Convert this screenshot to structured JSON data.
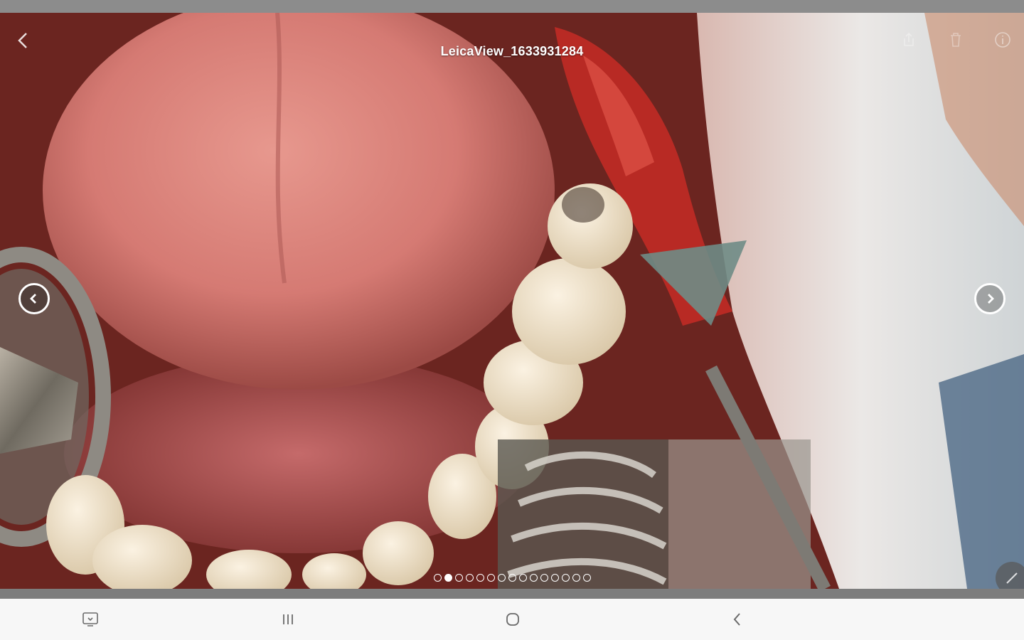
{
  "viewer": {
    "title": "LeicaView_1633931284",
    "photo_icon": "image-photo",
    "back_icon": "back-chevron",
    "share_icon": "share-icon",
    "delete_icon": "delete-icon",
    "info_icon": "info-icon",
    "prev_icon": "chevron-left-circle",
    "next_icon": "chevron-right-circle",
    "edit_icon": "pencil-icon",
    "page_indicator": {
      "count": 15,
      "active_index": 1
    }
  },
  "navbar": {
    "screenshot_icon": "screenshot-icon",
    "recents_icon": "recents-icon",
    "home_icon": "home-icon",
    "back_icon": "nav-back-icon"
  },
  "colors": {
    "nav_background": "#f7f7f7",
    "overlay_text": "#ffffff",
    "nav_icons": "#6a6a6a"
  }
}
